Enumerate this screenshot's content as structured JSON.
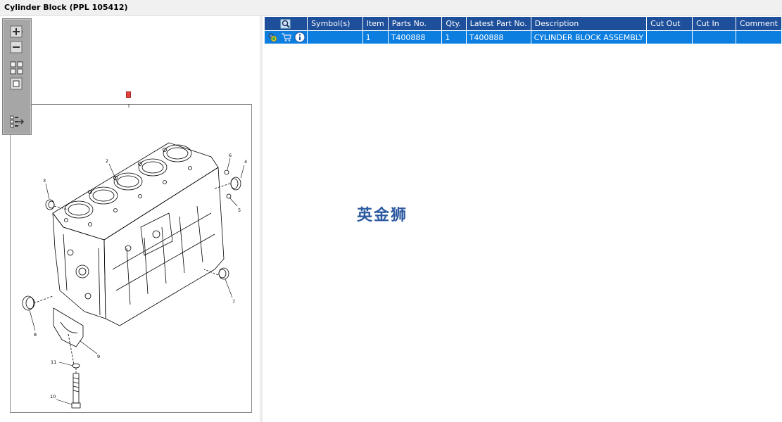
{
  "window": {
    "title": "Cylinder Block (PPL 105412)"
  },
  "toolbar": {
    "icons": [
      "zoom-in-icon",
      "zoom-out-icon",
      "fit-all-icon",
      "fit-window-icon",
      "show-list-icon"
    ]
  },
  "drawing": {
    "callouts": [
      "1",
      "2",
      "3",
      "4",
      "5",
      "6",
      "7",
      "8",
      "9",
      "10",
      "11"
    ]
  },
  "table": {
    "columns": [
      "",
      "Symbol(s)",
      "Item",
      "Parts No.",
      "Qty.",
      "Latest Part No.",
      "Description",
      "Cut Out",
      "Cut In",
      "Comment"
    ],
    "rows": [
      {
        "symbols": "",
        "item": "1",
        "parts_no": "T400888",
        "qty": "1",
        "latest_part_no": "T400888",
        "description": "CYLINDER BLOCK ASSEMBLY",
        "cut_out": "",
        "cut_in": "",
        "comment": ""
      }
    ]
  },
  "watermark": "英金狮",
  "colors": {
    "header_bg": "#1e4f9b",
    "selected_row_bg": "#0b7ee0",
    "toolbox_bg": "#a6a6a6",
    "watermark": "#2c5aa0",
    "marker": "#e0443a"
  }
}
